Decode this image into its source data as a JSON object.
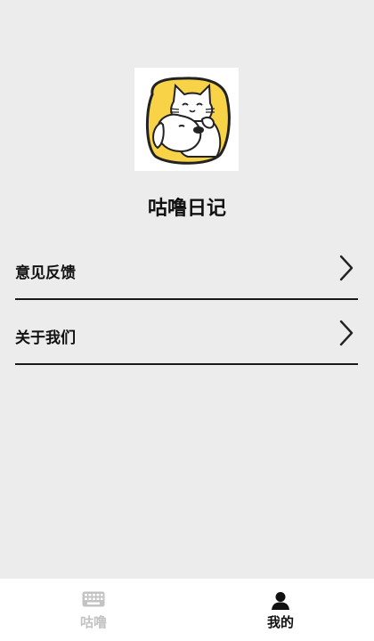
{
  "app": {
    "name": "咕噜日记"
  },
  "menu": {
    "items": [
      {
        "label": "意见反馈"
      },
      {
        "label": "关于我们"
      }
    ]
  },
  "tabbar": {
    "tabs": [
      {
        "label": "咕噜",
        "icon": "keyboard-icon",
        "active": false
      },
      {
        "label": "我的",
        "icon": "user-icon",
        "active": true
      }
    ]
  },
  "colors": {
    "background": "#ececec",
    "logo_yellow": "#f8d247",
    "tab_inactive": "#c3c3c3",
    "tab_active": "#111111"
  }
}
